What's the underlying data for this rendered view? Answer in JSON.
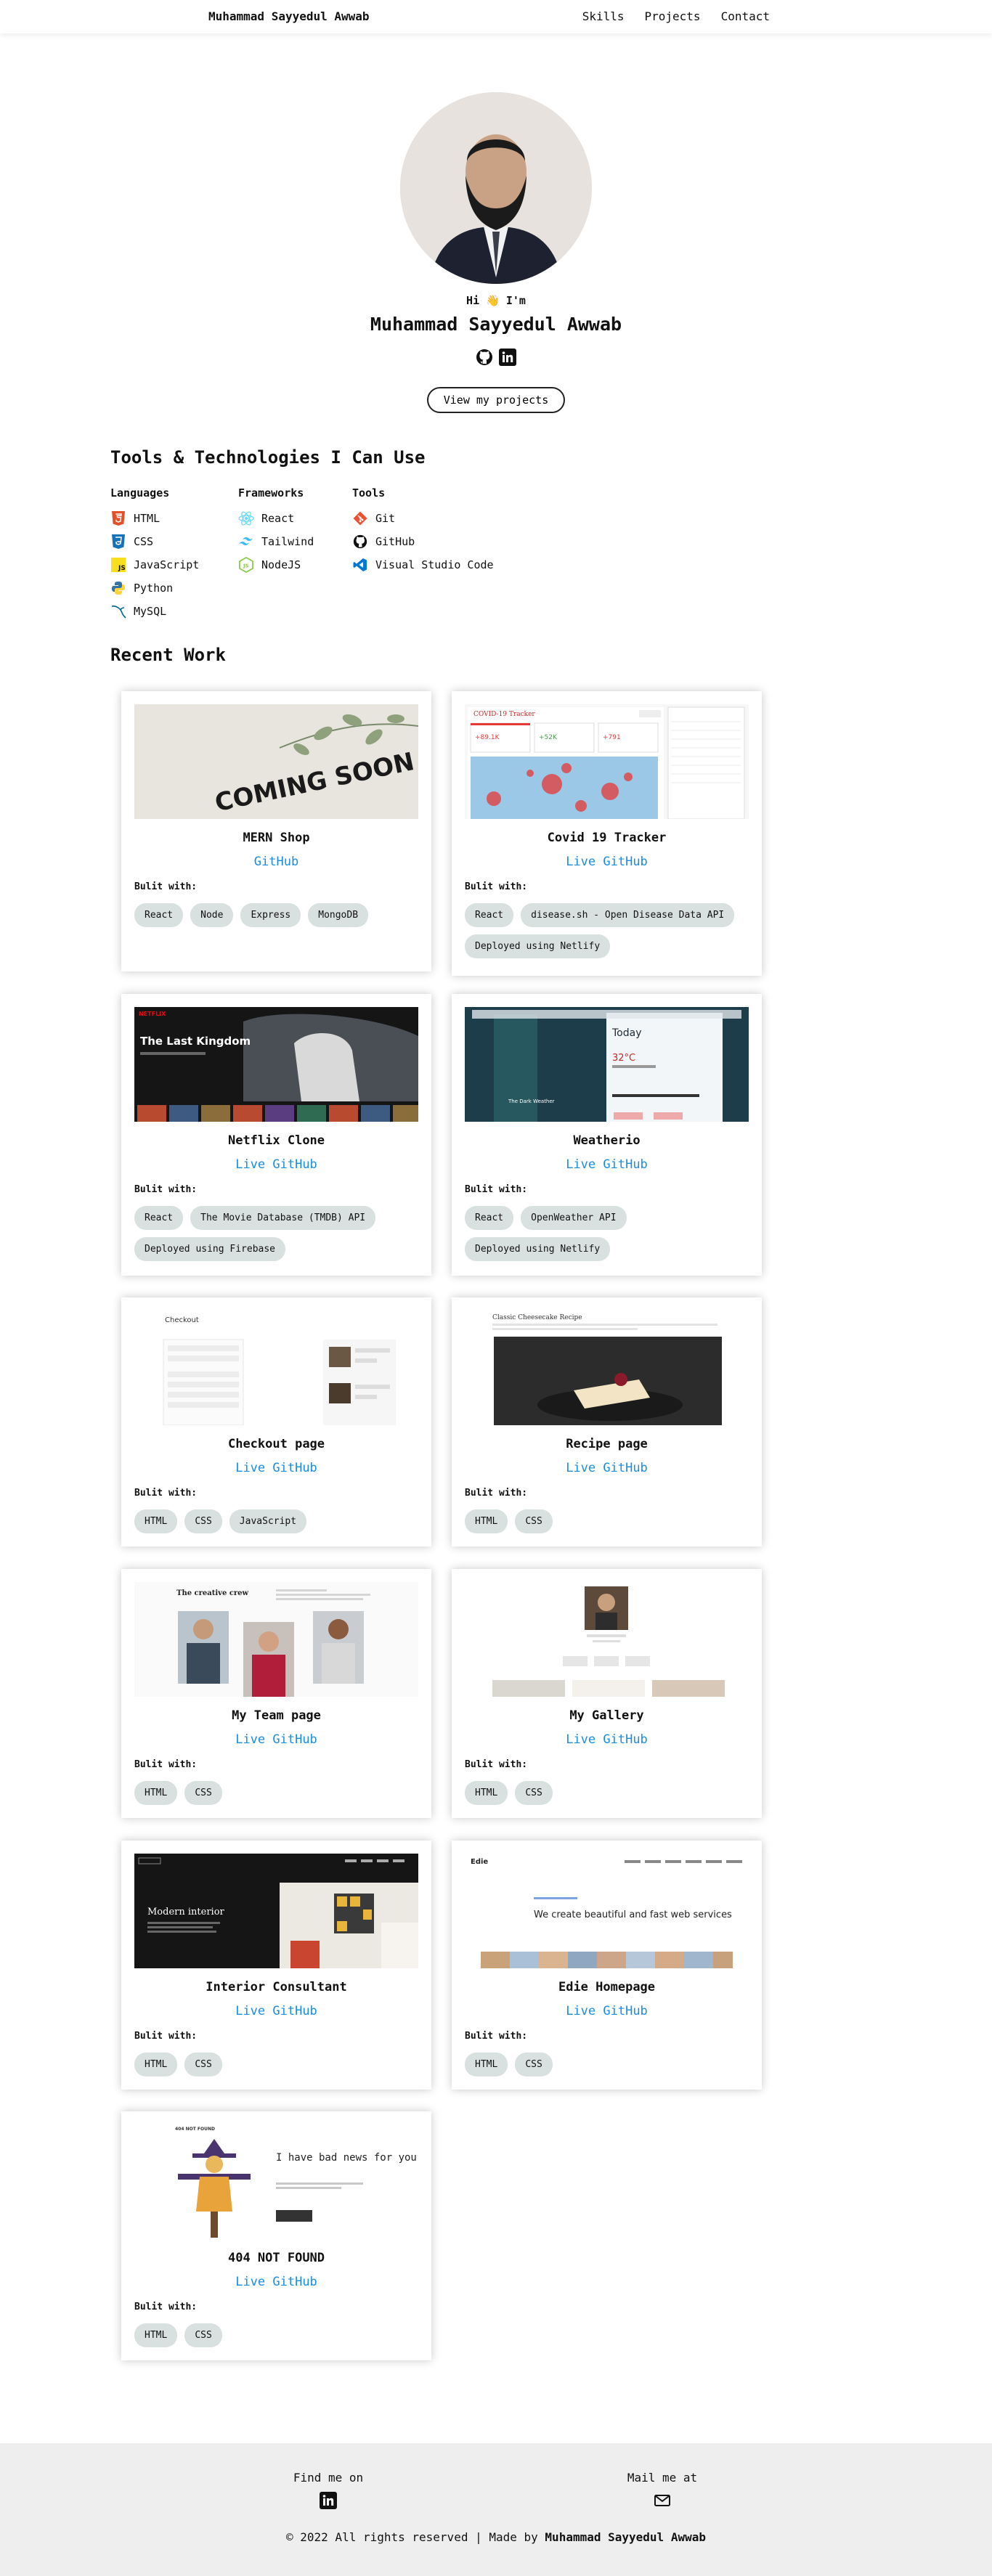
{
  "nav": {
    "brand": "Muhammad Sayyedul Awwab",
    "links": [
      "Skills",
      "Projects",
      "Contact"
    ]
  },
  "hero": {
    "greeting": "Hi 👋 I'm",
    "name": "Muhammad Sayyedul Awwab",
    "cta": "View my projects"
  },
  "skills": {
    "title": "Tools & Technologies I Can Use",
    "groups": [
      {
        "title": "Languages",
        "items": [
          "HTML",
          "CSS",
          "JavaScript",
          "Python",
          "MySQL"
        ]
      },
      {
        "title": "Frameworks",
        "items": [
          "React",
          "Tailwind",
          "NodeJS"
        ]
      },
      {
        "title": "Tools",
        "items": [
          "Git",
          "GitHub",
          "Visual Studio Code"
        ]
      }
    ]
  },
  "work": {
    "title": "Recent Work",
    "built_label": "Bulit with:",
    "projects": [
      {
        "title": "MERN Shop",
        "link": "GitHub",
        "tags": [
          "React",
          "Node",
          "Express",
          "MongoDB"
        ],
        "thumb_text": "COMING SOON"
      },
      {
        "title": "Covid 19 Tracker",
        "link": "Live GitHub",
        "tags": [
          "React",
          "disease.sh - Open Disease Data API",
          "Deployed using Netlify"
        ],
        "thumb_text": "COVID-19 Tracker"
      },
      {
        "title": "Netflix Clone",
        "link": "Live GitHub",
        "tags": [
          "React",
          "The Movie Database (TMDB) API",
          "Deployed using Firebase"
        ],
        "thumb_text": "The Last Kingdom"
      },
      {
        "title": "Weatherio",
        "link": "Live GitHub",
        "tags": [
          "React",
          "OpenWeather API",
          "Deployed using Netlify"
        ],
        "thumb_text": "Today"
      },
      {
        "title": "Checkout page",
        "link": "Live GitHub",
        "tags": [
          "HTML",
          "CSS",
          "JavaScript"
        ],
        "thumb_text": "Checkout"
      },
      {
        "title": "Recipe page",
        "link": "Live GitHub",
        "tags": [
          "HTML",
          "CSS"
        ],
        "thumb_text": "Classic Cheesecake Recipe"
      },
      {
        "title": "My Team page",
        "link": "Live GitHub",
        "tags": [
          "HTML",
          "CSS"
        ],
        "thumb_text": "The creative crew"
      },
      {
        "title": "My Gallery",
        "link": "Live GitHub",
        "tags": [
          "HTML",
          "CSS"
        ],
        "thumb_text": ""
      },
      {
        "title": "Interior Consultant",
        "link": "Live GitHub",
        "tags": [
          "HTML",
          "CSS"
        ],
        "thumb_text": "Modern interior"
      },
      {
        "title": "Edie Homepage",
        "link": "Live GitHub",
        "tags": [
          "HTML",
          "CSS"
        ],
        "thumb_text": "We create beautiful and fast web services"
      },
      {
        "title": "404 NOT FOUND",
        "link": "Live GitHub",
        "tags": [
          "HTML",
          "CSS"
        ],
        "thumb_text": "I have bad news for you"
      }
    ]
  },
  "footer": {
    "find_me": "Find me on",
    "mail_me": "Mail me at",
    "copyright": "© 2022 All rights reserved | Made by",
    "author": "Muhammad Sayyedul Awwab"
  },
  "colors": {
    "link": "#1a8de0",
    "tag_bg": "#d9e0e0",
    "footer_bg": "#eeeeee"
  }
}
